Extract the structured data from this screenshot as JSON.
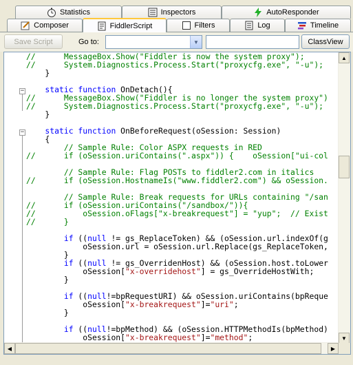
{
  "tabs_row1": [
    {
      "label": "Statistics",
      "icon": "stopwatch-icon"
    },
    {
      "label": "Inspectors",
      "icon": "inspectors-icon"
    },
    {
      "label": "AutoResponder",
      "icon": "lightning-icon"
    }
  ],
  "tabs_row2": [
    {
      "label": "Composer",
      "icon": "composer-icon"
    },
    {
      "label": "FiddlerScript",
      "icon": "script-icon",
      "active": true
    },
    {
      "label": "Filters",
      "icon": "checkbox-icon"
    },
    {
      "label": "Log",
      "icon": "log-icon"
    },
    {
      "label": "Timeline",
      "icon": "timeline-icon"
    }
  ],
  "toolbar": {
    "save_script": "Save Script",
    "goto_label": "Go to:",
    "goto_value": "",
    "search_value": "",
    "classview": "ClassView"
  },
  "code_lines": [
    [
      [
        "cmt",
        "//      MessageBox.Show(\"Fiddler is now the system proxy\");"
      ]
    ],
    [
      [
        "cmt",
        "//      System.Diagnostics.Process.Start(\"proxycfg.exe\", \"-u\");"
      ]
    ],
    [
      [
        "",
        "    }"
      ]
    ],
    [
      [
        "",
        ""
      ]
    ],
    [
      [
        "kw",
        "    static function"
      ],
      [
        "",
        " OnDetach(){"
      ]
    ],
    [
      [
        "cmt",
        "//      MessageBox.Show(\"Fiddler is no longer the system proxy\")"
      ]
    ],
    [
      [
        "cmt",
        "//      System.Diagnostics.Process.Start(\"proxycfg.exe\", \"-u\");"
      ]
    ],
    [
      [
        "",
        "    }"
      ]
    ],
    [
      [
        "",
        ""
      ]
    ],
    [
      [
        "kw",
        "    static function"
      ],
      [
        "",
        " OnBeforeRequest(oSession: Session)"
      ]
    ],
    [
      [
        "",
        "    {"
      ]
    ],
    [
      [
        "cmt",
        "        // Sample Rule: Color ASPX requests in RED"
      ]
    ],
    [
      [
        "cmt",
        "//      if (oSession.uriContains(\".aspx\")) {    oSession[\"ui-col"
      ]
    ],
    [
      [
        "",
        ""
      ]
    ],
    [
      [
        "cmt",
        "        // Sample Rule: Flag POSTs to fiddler2.com in italics"
      ]
    ],
    [
      [
        "cmt",
        "//      if (oSession.HostnameIs(\"www.fiddler2.com\") && oSession."
      ]
    ],
    [
      [
        "",
        ""
      ]
    ],
    [
      [
        "cmt",
        "        // Sample Rule: Break requests for URLs containing \"/san"
      ]
    ],
    [
      [
        "cmt",
        "//      if (oSession.uriContains(\"/sandbox/\")){"
      ]
    ],
    [
      [
        "cmt",
        "//          oSession.oFlags[\"x-breakrequest\"] = \"yup\";  // Exist"
      ]
    ],
    [
      [
        "cmt",
        "//      }"
      ]
    ],
    [
      [
        "",
        ""
      ]
    ],
    [
      [
        "kw",
        "        if"
      ],
      [
        "",
        " (("
      ],
      [
        "kw",
        "null"
      ],
      [
        "",
        " != gs_ReplaceToken) && (oSession.url.indexOf(g"
      ]
    ],
    [
      [
        "",
        "            oSession.url = oSession.url.Replace(gs_ReplaceToken,"
      ]
    ],
    [
      [
        "",
        "        }"
      ]
    ],
    [
      [
        "kw",
        "        if"
      ],
      [
        "",
        " (("
      ],
      [
        "kw",
        "null"
      ],
      [
        "",
        " != gs_OverridenHost) && (oSession.host.toLower"
      ]
    ],
    [
      [
        "",
        "            oSession["
      ],
      [
        "str",
        "\"x-overridehost\""
      ],
      [
        "",
        "] = gs_OverrideHostWith;"
      ]
    ],
    [
      [
        "",
        "        }"
      ]
    ],
    [
      [
        "",
        ""
      ]
    ],
    [
      [
        "kw",
        "        if"
      ],
      [
        "",
        " (("
      ],
      [
        "kw",
        "null"
      ],
      [
        "",
        "!=bpRequestURI) && oSession.uriContains(bpReque"
      ]
    ],
    [
      [
        "",
        "            oSession["
      ],
      [
        "str",
        "\"x-breakrequest\""
      ],
      [
        "",
        "]="
      ],
      [
        "str",
        "\"uri\""
      ],
      [
        "",
        ";"
      ]
    ],
    [
      [
        "",
        "        }"
      ]
    ],
    [
      [
        "",
        ""
      ]
    ],
    [
      [
        "kw",
        "        if"
      ],
      [
        "",
        " (("
      ],
      [
        "kw",
        "null"
      ],
      [
        "",
        "!=bpMethod) && (oSession.HTTPMethodIs(bpMethod)"
      ]
    ],
    [
      [
        "",
        "            oSession["
      ],
      [
        "str",
        "\"x-breakrequest\""
      ],
      [
        "",
        "]="
      ],
      [
        "str",
        "\"method\""
      ],
      [
        "",
        ";"
      ]
    ],
    [
      [
        "",
        "        }"
      ]
    ]
  ],
  "colors": {
    "comment": "#008000",
    "keyword": "#0000ff",
    "string": "#a31515",
    "active_tab_accent": "#ffc83c"
  }
}
